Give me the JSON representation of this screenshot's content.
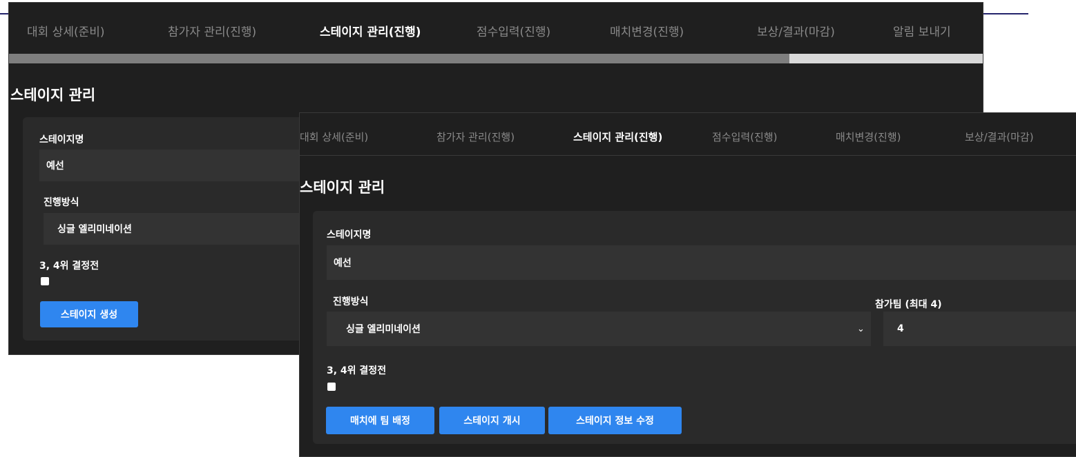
{
  "tabs": [
    {
      "label": "대회 상세(준비)"
    },
    {
      "label": "참가자 관리(진행)"
    },
    {
      "label": "스테이지 관리(진행)"
    },
    {
      "label": "점수입력(진행)"
    },
    {
      "label": "매치변경(진행)"
    },
    {
      "label": "보상/결과(마감)"
    },
    {
      "label": "알림 보내기"
    }
  ],
  "progress_fraction": 0.8,
  "page_title": "스테이지 관리",
  "form": {
    "stage_name_label": "스테이지명",
    "stage_name_value": "예선",
    "format_label": "진행방식",
    "format_value": "싱글 엘리미네이션",
    "team_label": "참가팀 (최대 4)",
    "team_value": "4",
    "third_place_label": "3, 4위 결정전"
  },
  "buttons": {
    "create": "스테이지 생성",
    "assign": "매치에 팀 배정",
    "start": "스테이지 개시",
    "edit": "스테이지 정보 수정"
  },
  "colors": {
    "accent": "#2f86ef",
    "panel": "#1f1f1f",
    "card": "#2a2a2a",
    "field": "#333333"
  }
}
